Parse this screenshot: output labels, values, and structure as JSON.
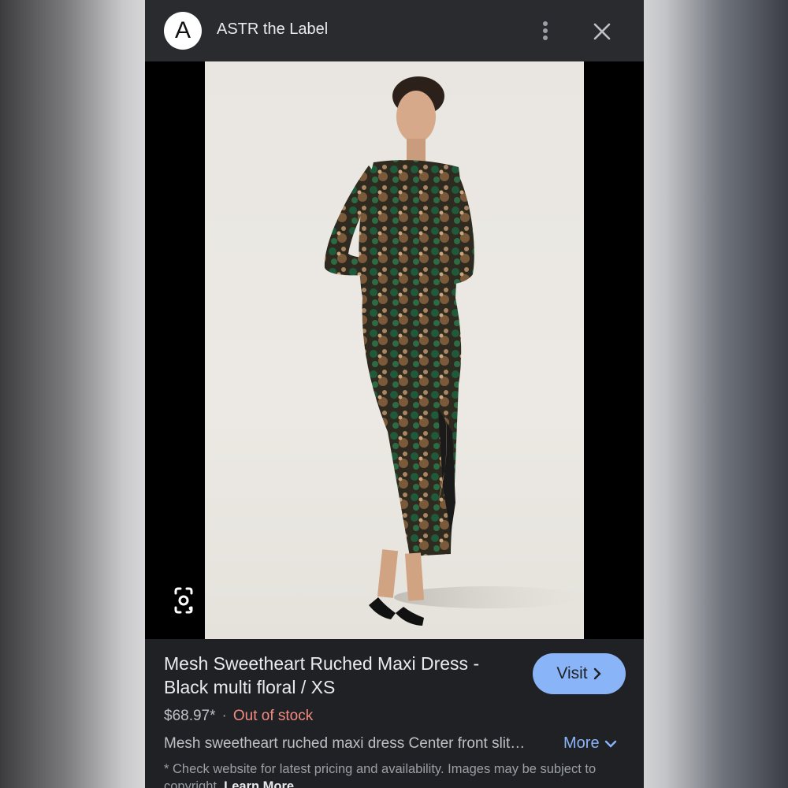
{
  "header": {
    "logo_letter": "A",
    "site_name": "ASTR the Label",
    "menu_icon": "more-vert-icon",
    "close_icon": "close-icon"
  },
  "image": {
    "lens_icon": "google-lens-icon"
  },
  "product": {
    "title": "Mesh Sweetheart Ruched Maxi Dress - Black multi floral / XS",
    "visit_label": "Visit",
    "price": "$68.97*",
    "separator": "·",
    "stock_status": "Out of stock",
    "description": "Mesh sweetheart ruched maxi dress Center front slit…",
    "more_label": "More",
    "disclaimer": "* Check website for latest pricing and availability. Images may be subject to copyright.",
    "learn_more_label": "Learn More"
  },
  "colors": {
    "panel_bg": "#202124",
    "header_bg": "#2a2b2e",
    "accent_blue": "#8ab4f8",
    "out_of_stock_red": "#f28b82"
  }
}
